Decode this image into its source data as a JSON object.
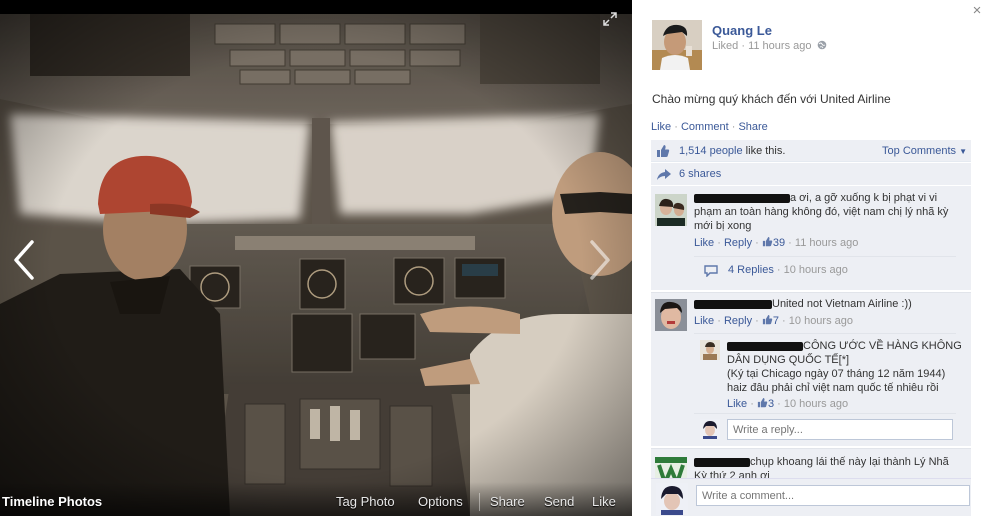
{
  "photo_bar": {
    "album": "Timeline Photos",
    "tag_photo": "Tag Photo",
    "options": "Options",
    "share": "Share",
    "send": "Send",
    "like": "Like"
  },
  "post": {
    "close": "×",
    "owner_name": "Quang Le",
    "owner_meta": "Liked · 11 hours ago",
    "text": "Chào mừng quý khách đến với United Airline",
    "actions": {
      "like": "Like",
      "comment": "Comment",
      "share": "Share"
    },
    "likes": {
      "count": "1,514 people",
      "suffix": " like this.",
      "top_comments": "Top Comments"
    },
    "shares": "6 shares"
  },
  "comments": [
    {
      "line1": "a ơi, a gỡ xuống k bị phạt vi vi",
      "line2": "phạm an toàn hàng không đó, việt nam chị lý nhã kỳ",
      "line3": "mới bị xong",
      "like": "Like",
      "reply": "Reply",
      "likes": "39",
      "time": "11 hours ago",
      "replies_count": "4 Replies",
      "replies_time": "10 hours ago"
    },
    {
      "text": "United not Vietnam Airline :))",
      "like": "Like",
      "reply": "Reply",
      "likes": "7",
      "time": "10 hours ago",
      "reply_item": {
        "line1": "CÔNG ƯỚC VỀ HÀNG KHÔNG",
        "line2": "DÂN DỤNG QUỐC TẾ[*]",
        "line3": "(Ký tại Chicago ngày 07 tháng 12 năm 1944)",
        "line4": "haiz đâu phải chỉ việt nam quốc tế nhiêu rồi",
        "like": "Like",
        "likes": "3",
        "time": "10 hours ago"
      },
      "reply_placeholder": "Write a reply..."
    },
    {
      "line1": "chụp khoang lái thế này lại thành Lý Nhã",
      "line2": "Kỳ thứ 2 anh ơi"
    }
  ],
  "comment_placeholder": "Write a comment...",
  "colors": {
    "link": "#3b5998",
    "panel_bg": "#edeff4",
    "photo_bg": "#000000"
  },
  "icons": [
    "expand-icon",
    "chevron-left-icon",
    "chevron-right-icon",
    "close-icon",
    "globe-icon",
    "thumbs-up-icon",
    "share-icon",
    "replies-icon"
  ]
}
